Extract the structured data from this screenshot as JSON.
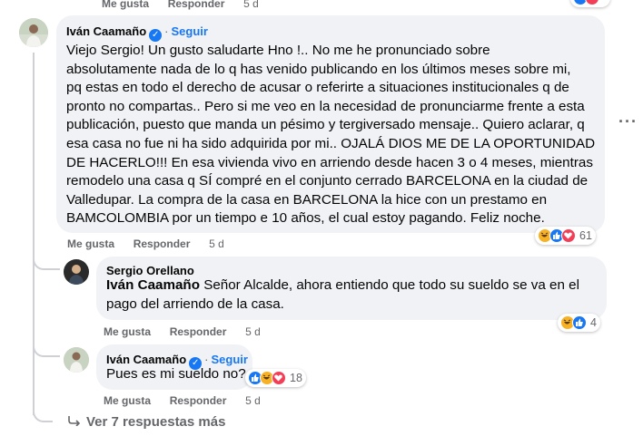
{
  "top": {
    "like_label": "Me gusta",
    "reply_label": "Responder",
    "time": "5 d"
  },
  "comment1": {
    "author": "Iván Caamaño",
    "follow_label": "Seguir",
    "lines": [
      "Viejo Sergio! Un gusto saludarte Hno !.. No me he pronunciado sobre",
      "absolutamente nada de lo q has venido publicando en los últimos meses sobre mi,",
      "pq estas en todo el derecho de acusar o referirte a situaciones institucionales q de",
      "pronto no compartas.. Pero si me veo en la necesidad de pronunciarme frente a esta",
      "publicación, puesto que manda un pésimo y tergiversado mensaje.. Quiero aclarar, q",
      "esa casa no fue ni ha sido adquirida por mi.. OJALÁ DIOS ME DE LA OPORTUNIDAD",
      "DE HACERLO!!! En esa vivienda vivo en arriendo desde hacen 3 o 4 meses, mientras",
      "remodelo una casa q SÍ compré en el conjunto cerrado BARCELONA en la ciudad de",
      "Valledupar. La compra de la casa en BARCELONA la hice con un prestamo en",
      "BAMCOLOMBIA por un tiempo e 10 años, el cual estoy pagando. Feliz noche."
    ],
    "like_label": "Me gusta",
    "reply_label": "Responder",
    "time": "5 d",
    "reaction_count": "61",
    "reactions": [
      "haha",
      "like",
      "love"
    ]
  },
  "reply1": {
    "author": "Sergio Orellano",
    "mention": "Iván Caamaño",
    "line1_rest": " Señor Alcalde, ahora entiendo que todo su sueldo se va en el",
    "line2": "pago del arriendo de la casa.",
    "like_label": "Me gusta",
    "reply_label": "Responder",
    "time": "5 d",
    "reaction_count": "4",
    "reactions": [
      "haha",
      "like"
    ]
  },
  "reply2": {
    "author": "Iván Caamaño",
    "follow_label": "Seguir",
    "text": "Pues es mi sueldo no?",
    "like_label": "Me gusta",
    "reply_label": "Responder",
    "time": "5 d",
    "reaction_count": "18",
    "reactions": [
      "like",
      "haha",
      "love"
    ]
  },
  "more_replies": {
    "label": "Ver 7 respuestas más"
  },
  "colors": {
    "bubble": "#f0f2f5",
    "link": "#1877f2",
    "meta": "#65676b"
  }
}
